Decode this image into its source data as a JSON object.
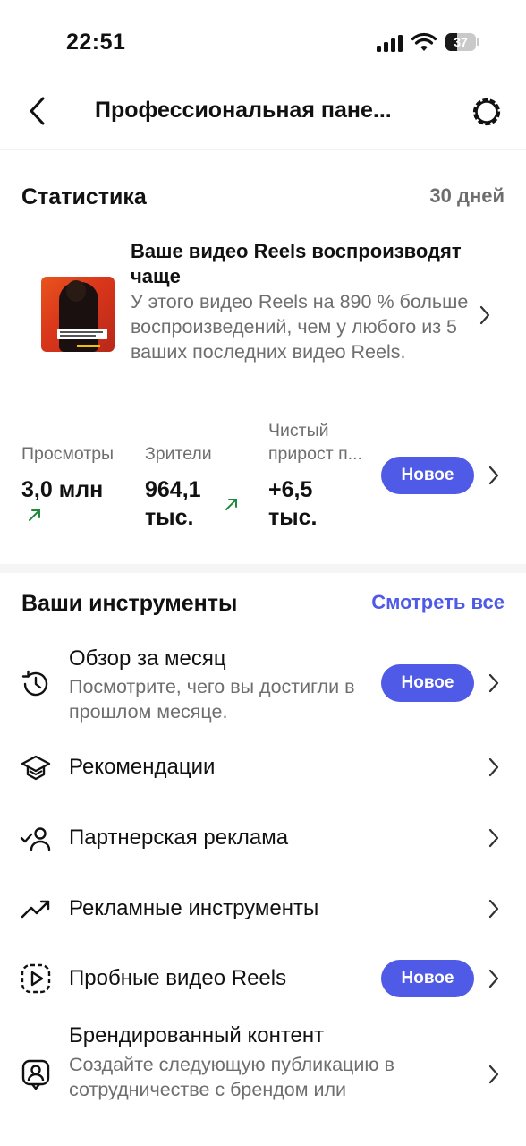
{
  "status_bar": {
    "time": "22:51",
    "battery": "37",
    "battery_level": 0.37
  },
  "header": {
    "title": "Профессиональная пане..."
  },
  "stats": {
    "heading": "Статистика",
    "period": "30 дней",
    "insight": {
      "title": "Ваше видео Reels воспроизводят чаще",
      "description": "У этого видео Reels на 890 % больше воспроизведений, чем у любого из 5 ваших последних видео Reels."
    },
    "metrics": [
      {
        "label": "Просмотры",
        "value": "3,0 млн",
        "trend": "up"
      },
      {
        "label": "Зрители",
        "value_line1": "964,1",
        "value_line2": "тыс.",
        "trend": "up"
      },
      {
        "label_line1": "Чистый",
        "label_line2": "прирост п...",
        "value_line1": "+6,5",
        "value_line2": "тыс."
      }
    ],
    "badge": "Новое"
  },
  "tools": {
    "heading": "Ваши инструменты",
    "see_all": "Смотреть все",
    "items": [
      {
        "icon": "history-icon",
        "title": "Обзор за месяц",
        "subtitle": "Посмотрите, чего вы достигли в прошлом месяце.",
        "badge": "Новое"
      },
      {
        "icon": "graduation-cap-icon",
        "title": "Рекомендации"
      },
      {
        "icon": "partner-check-icon",
        "title": "Партнерская реклама"
      },
      {
        "icon": "trending-up-icon",
        "title": "Рекламные инструменты"
      },
      {
        "icon": "reels-trial-icon",
        "title": "Пробные видео Reels",
        "badge": "Новое"
      },
      {
        "icon": "branded-content-icon",
        "title": "Брендированный контент",
        "subtitle": "Создайте следующую публикацию в сотрудничестве с брендом или"
      }
    ]
  },
  "colors": {
    "accent": "#4f5ae6",
    "trend": "#1e8a3c",
    "muted": "#6e6e6e"
  }
}
